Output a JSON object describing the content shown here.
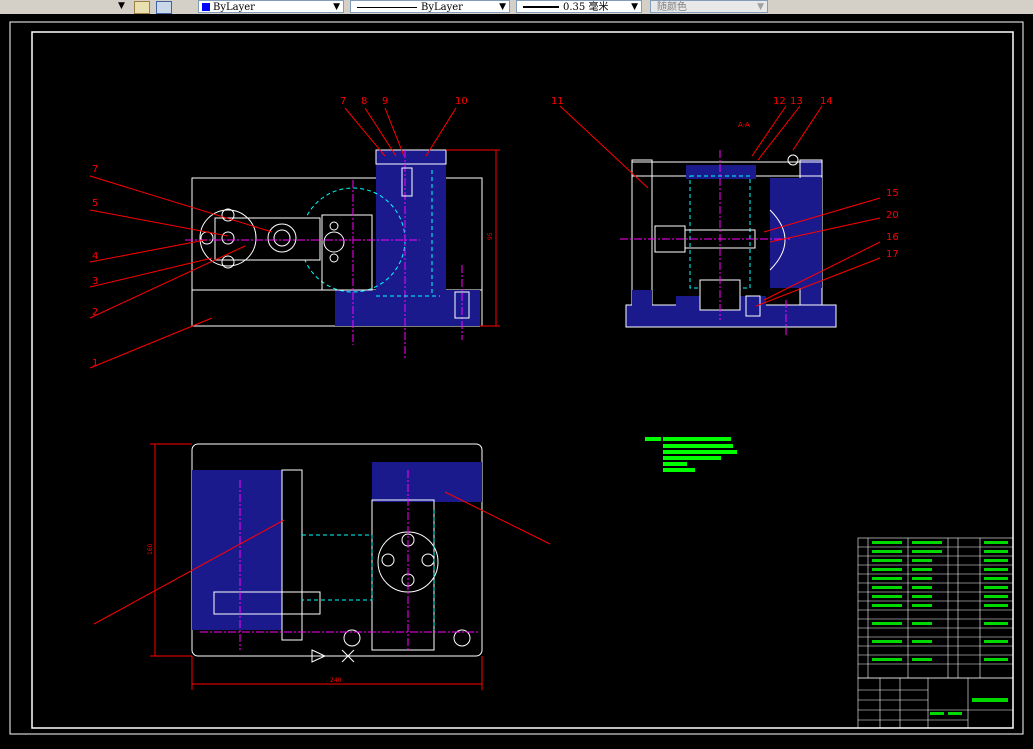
{
  "toolbar": {
    "layer_icon_1": "layer-stack-icon",
    "layer_icon_2": "layer-previous-icon",
    "color_combo": {
      "value": "ByLayer",
      "color": "#0000ff"
    },
    "linetype_combo": {
      "value": "ByLayer"
    },
    "lineweight_combo": {
      "value": "0.35 毫米"
    },
    "plotstyle_combo": {
      "value": "随颜色"
    }
  },
  "drawing": {
    "colors": {
      "outline": "#ffffff",
      "leader": "#ff0000",
      "center": "#ff00ff",
      "hidden": "#00ffff",
      "fill": "#1a1a8c",
      "text_green": "#00ff00"
    },
    "balloons": [
      "1",
      "2",
      "3",
      "4",
      "5",
      "6",
      "7",
      "8",
      "9",
      "10",
      "11",
      "12",
      "13",
      "14",
      "15",
      "16",
      "17",
      "20"
    ],
    "section_label": "A-A",
    "dim_front_height": "95",
    "dim_plan_width": "240",
    "dim_plan_height": "160"
  }
}
